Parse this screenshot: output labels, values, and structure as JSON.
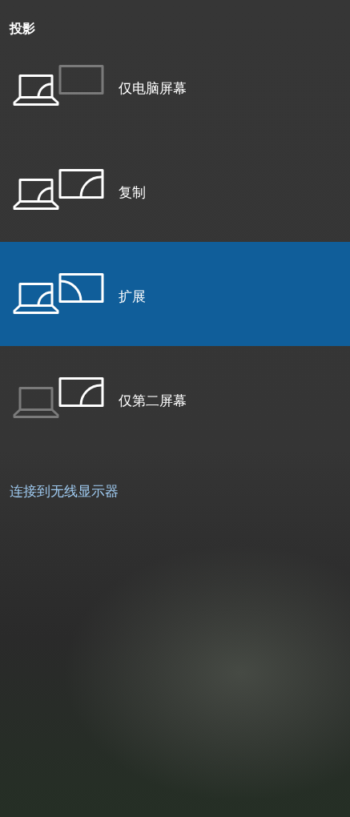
{
  "panel": {
    "title": "投影",
    "options": [
      {
        "kind": "pc_only",
        "label": "仅电脑屏幕",
        "selected": false
      },
      {
        "kind": "duplicate",
        "label": "复制",
        "selected": false
      },
      {
        "kind": "extend",
        "label": "扩展",
        "selected": true
      },
      {
        "kind": "second_only",
        "label": "仅第二屏幕",
        "selected": false
      }
    ],
    "link": "连接到无线显示器"
  }
}
